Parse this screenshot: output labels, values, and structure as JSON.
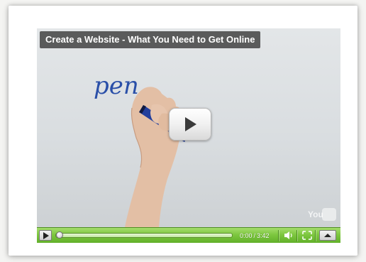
{
  "video": {
    "title": "Create a Website - What You Need to Get Online",
    "board_text": "pen"
  },
  "watermark": {
    "name": "youtube-watermark",
    "you": "You"
  },
  "controls": {
    "current_time": "0:00",
    "separator": "/",
    "duration": "3:42",
    "progress": 0.0,
    "icons": {
      "play": "play-icon",
      "volume": "volume-icon",
      "fullscreen": "fullscreen-icon",
      "popout": "popout-icon",
      "big_play": "big-play-icon"
    }
  },
  "colors": {
    "control_bar": "#7cc63e",
    "title_bg": "#3c3c3c",
    "ink": "#2a4fa8"
  }
}
